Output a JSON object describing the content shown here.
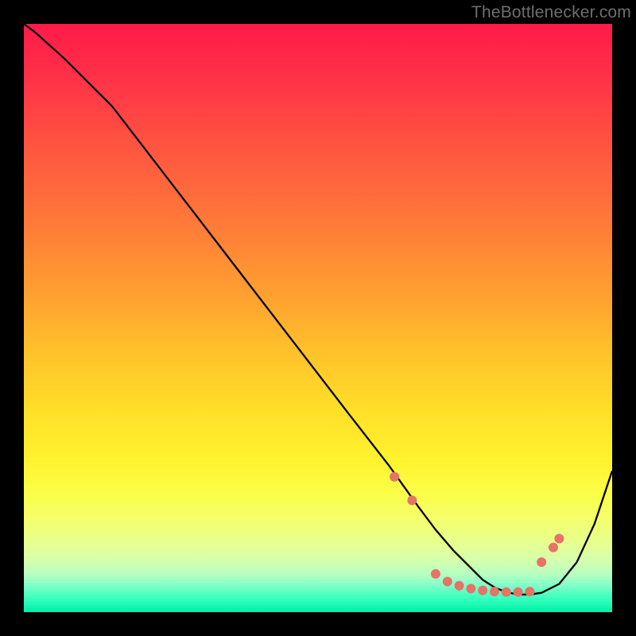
{
  "watermark": "TheBottlenecker.com",
  "colors": {
    "frame_bg": "#000000",
    "curve_stroke": "#000000",
    "dot_fill": "#e57368"
  },
  "chart_data": {
    "type": "line",
    "title": "",
    "xlabel": "",
    "ylabel": "",
    "xlim": [
      0,
      100
    ],
    "ylim": [
      0,
      100
    ],
    "series": [
      {
        "name": "curve",
        "x": [
          0,
          2,
          7,
          15,
          25,
          35,
          45,
          55,
          62,
          67,
          70,
          73,
          76,
          78,
          80,
          82,
          84,
          86,
          88,
          91,
          94,
          97,
          100
        ],
        "y": [
          100,
          98.5,
          94,
          86,
          73,
          60,
          47,
          34,
          25,
          18,
          14,
          10.5,
          7.5,
          5.5,
          4.2,
          3.4,
          3,
          3,
          3.3,
          4.8,
          8.5,
          15,
          24
        ]
      }
    ],
    "markers": {
      "name": "highlight-dots",
      "x": [
        63,
        66,
        70,
        72,
        74,
        76,
        78,
        80,
        82,
        84,
        86,
        88,
        90,
        91
      ],
      "y": [
        23,
        19,
        6.5,
        5.2,
        4.5,
        4.0,
        3.7,
        3.5,
        3.4,
        3.4,
        3.5,
        8.5,
        11,
        12.5
      ]
    },
    "gradient_colors": {
      "top": "#ff1a4a",
      "upper_mid": "#ffa030",
      "mid": "#ffe028",
      "lower_mid": "#e8ff8e",
      "bottom": "#00f0a8"
    }
  }
}
